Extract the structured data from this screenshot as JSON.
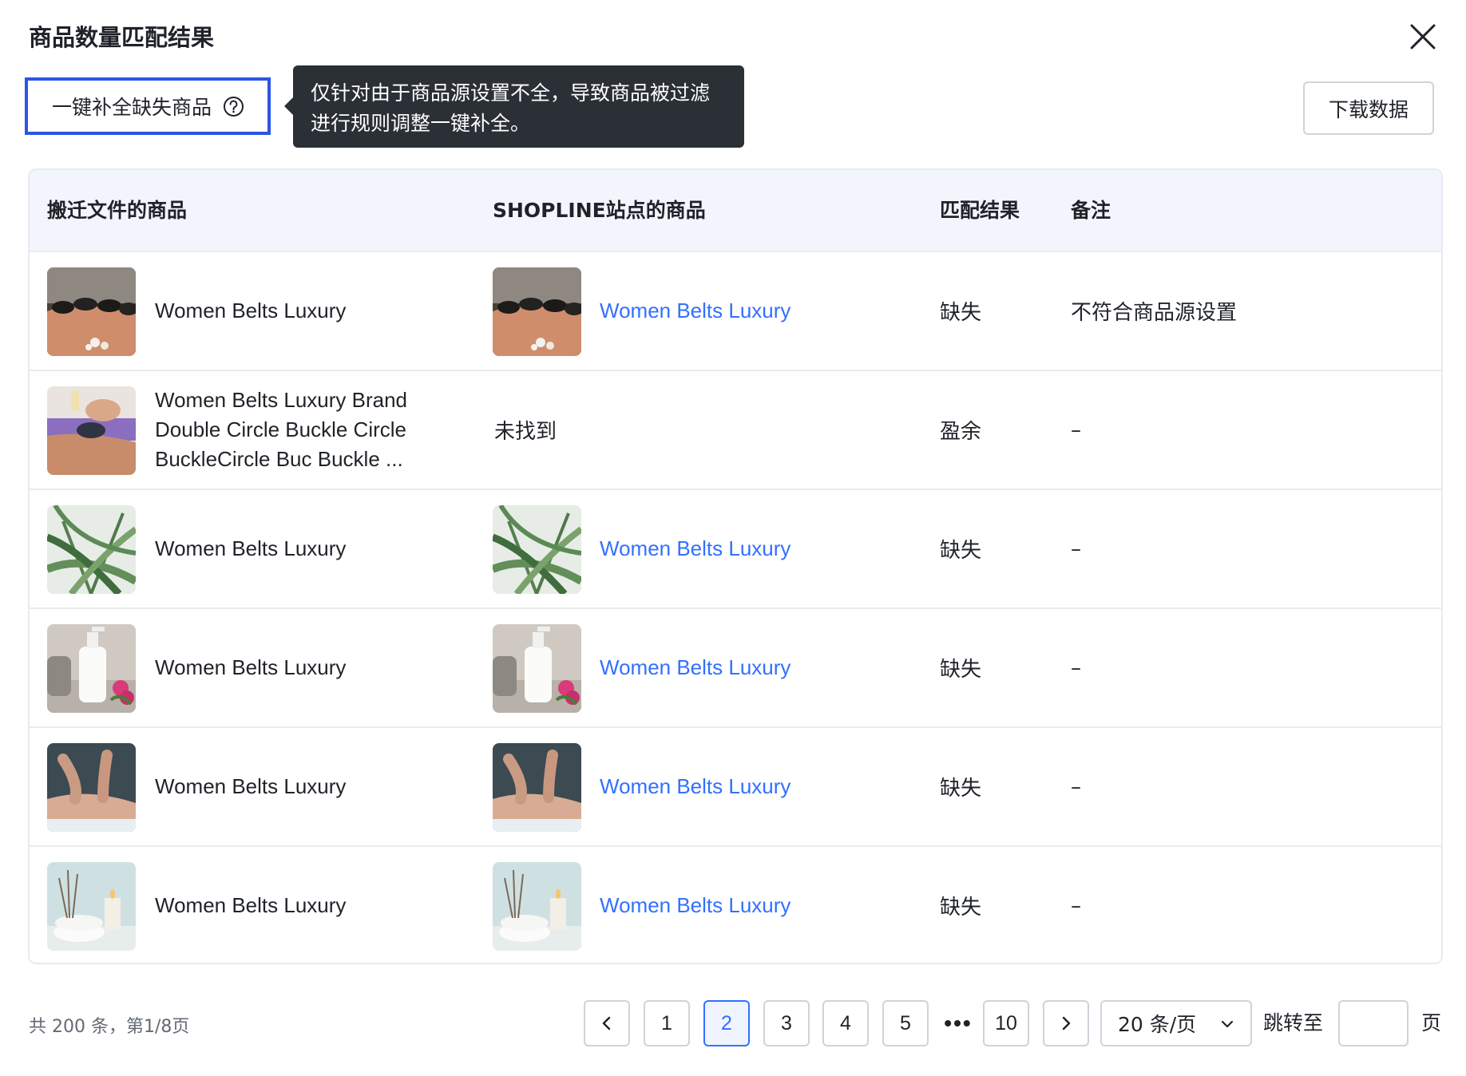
{
  "dialog": {
    "title": "商品数量匹配结果",
    "close_icon": "close-icon"
  },
  "toolbar": {
    "fill_missing_label": "一键补全缺失商品",
    "help_icon": "question-circle-icon",
    "tooltip_line1": "仅针对由于商品源设置不全，导致商品被过滤",
    "tooltip_line2": "进行规则调整一键补全。",
    "download_label": "下载数据"
  },
  "table": {
    "headers": {
      "source": "搬迁文件的商品",
      "shopline": "SHOPLINE站点的商品",
      "result": "匹配结果",
      "note": "备注"
    },
    "rows": [
      {
        "image": "stones-massage",
        "source_name": "Women Belts Luxury",
        "shopline_name": "Women Belts Luxury",
        "shopline_found": true,
        "result": "缺失",
        "note": "不符合商品源设置"
      },
      {
        "image": "oil-massage",
        "source_name": "Women Belts Luxury Brand Double Circle Buckle Circle BuckleCircle Buc Buckle ...",
        "shopline_name": "未找到",
        "shopline_found": false,
        "result": "盈余",
        "note": "–"
      },
      {
        "image": "palm-leaves",
        "source_name": "Women Belts Luxury",
        "shopline_name": "Women Belts Luxury",
        "shopline_found": true,
        "result": "缺失",
        "note": "–"
      },
      {
        "image": "lotion-bottle",
        "source_name": "Women Belts Luxury",
        "shopline_name": "Women Belts Luxury",
        "shopline_found": true,
        "result": "缺失",
        "note": "–"
      },
      {
        "image": "back-massage",
        "source_name": "Women Belts Luxury",
        "shopline_name": "Women Belts Luxury",
        "shopline_found": true,
        "result": "缺失",
        "note": "–"
      },
      {
        "image": "spa-candle",
        "source_name": "Women Belts Luxury",
        "shopline_name": "Women Belts Luxury",
        "shopline_found": true,
        "result": "缺失",
        "note": "–"
      }
    ]
  },
  "pagination": {
    "total_text": "共 200 条，第1/8页",
    "prev_icon": "chevron-left-icon",
    "next_icon": "chevron-right-icon",
    "pages": [
      "1",
      "2",
      "3",
      "4",
      "5"
    ],
    "active_page": "2",
    "ellipsis": "•••",
    "last_page": "10",
    "page_size": "20 条/页",
    "page_size_icon": "chevron-down-icon",
    "jump_label": "跳转至",
    "jump_value": "",
    "page_suffix": "页"
  },
  "colors": {
    "link": "#3370ff",
    "tooltip_bg": "#2b2f36",
    "focus_border": "#2b55e5",
    "header_bg": "#f2f5fc"
  }
}
